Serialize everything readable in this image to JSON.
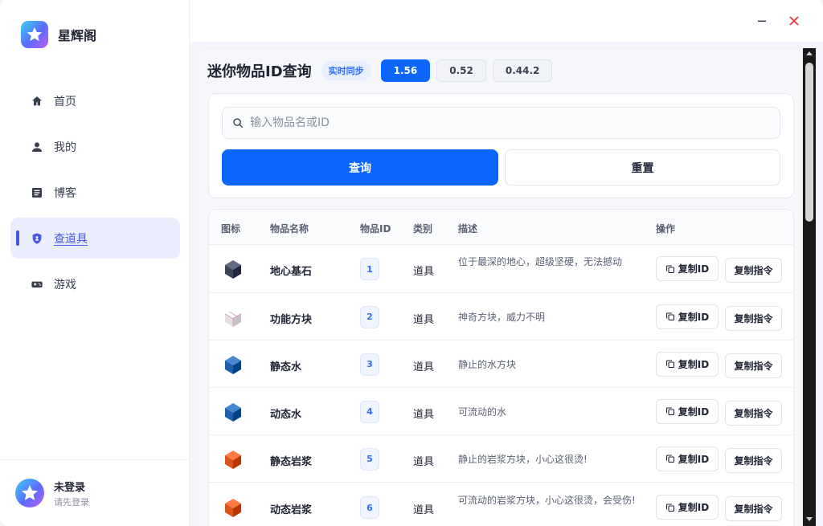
{
  "app": {
    "name": "星辉阁"
  },
  "sidebar": {
    "items": [
      {
        "label": "首页",
        "icon": "home-icon"
      },
      {
        "label": "我的",
        "icon": "user-icon"
      },
      {
        "label": "博客",
        "icon": "blog-icon"
      },
      {
        "label": "查道具",
        "icon": "shield-icon",
        "active": true
      },
      {
        "label": "游戏",
        "icon": "gamepad-icon"
      }
    ],
    "user": {
      "name": "未登录",
      "sub": "请先登录"
    }
  },
  "page": {
    "title": "迷你物品ID查询",
    "sync_badge": "实时同步",
    "versions": [
      "1.56",
      "0.52",
      "0.44.2"
    ],
    "active_version": "1.56"
  },
  "search": {
    "placeholder": "输入物品名或ID",
    "query_label": "查询",
    "reset_label": "重置"
  },
  "table": {
    "headers": {
      "icon": "图标",
      "name": "物品名称",
      "id": "物品ID",
      "category": "类别",
      "desc": "描述",
      "actions": "操作"
    },
    "copy_id_label": "复制ID",
    "copy_cmd_label": "复制指令",
    "rows": [
      {
        "name": "地心基石",
        "id": "1",
        "category": "道具",
        "desc": "位于最深的地心，超级坚硬，无法撼动",
        "block": "bedrock",
        "color": "#3d4358"
      },
      {
        "name": "功能方块",
        "id": "2",
        "category": "道具",
        "desc": "神奇方块，威力不明",
        "block": "function",
        "color": "#e6dfe6"
      },
      {
        "name": "静态水",
        "id": "3",
        "category": "道具",
        "desc": "静止的水方块",
        "block": "water",
        "color": "#1d5fa8"
      },
      {
        "name": "动态水",
        "id": "4",
        "category": "道具",
        "desc": "可流动的水",
        "block": "water",
        "color": "#1d5fa8"
      },
      {
        "name": "静态岩浆",
        "id": "5",
        "category": "道具",
        "desc": "静止的岩浆方块，小心这很烫!",
        "block": "lava",
        "color": "#d9531c"
      },
      {
        "name": "动态岩浆",
        "id": "6",
        "category": "道具",
        "desc": "可流动的岩浆方块，小心这很烫，会受伤!",
        "block": "lava",
        "color": "#d9531c"
      }
    ]
  },
  "colors": {
    "accent": "#0a66ff",
    "nav_active": "#4a57e0",
    "close": "#e5383b"
  }
}
